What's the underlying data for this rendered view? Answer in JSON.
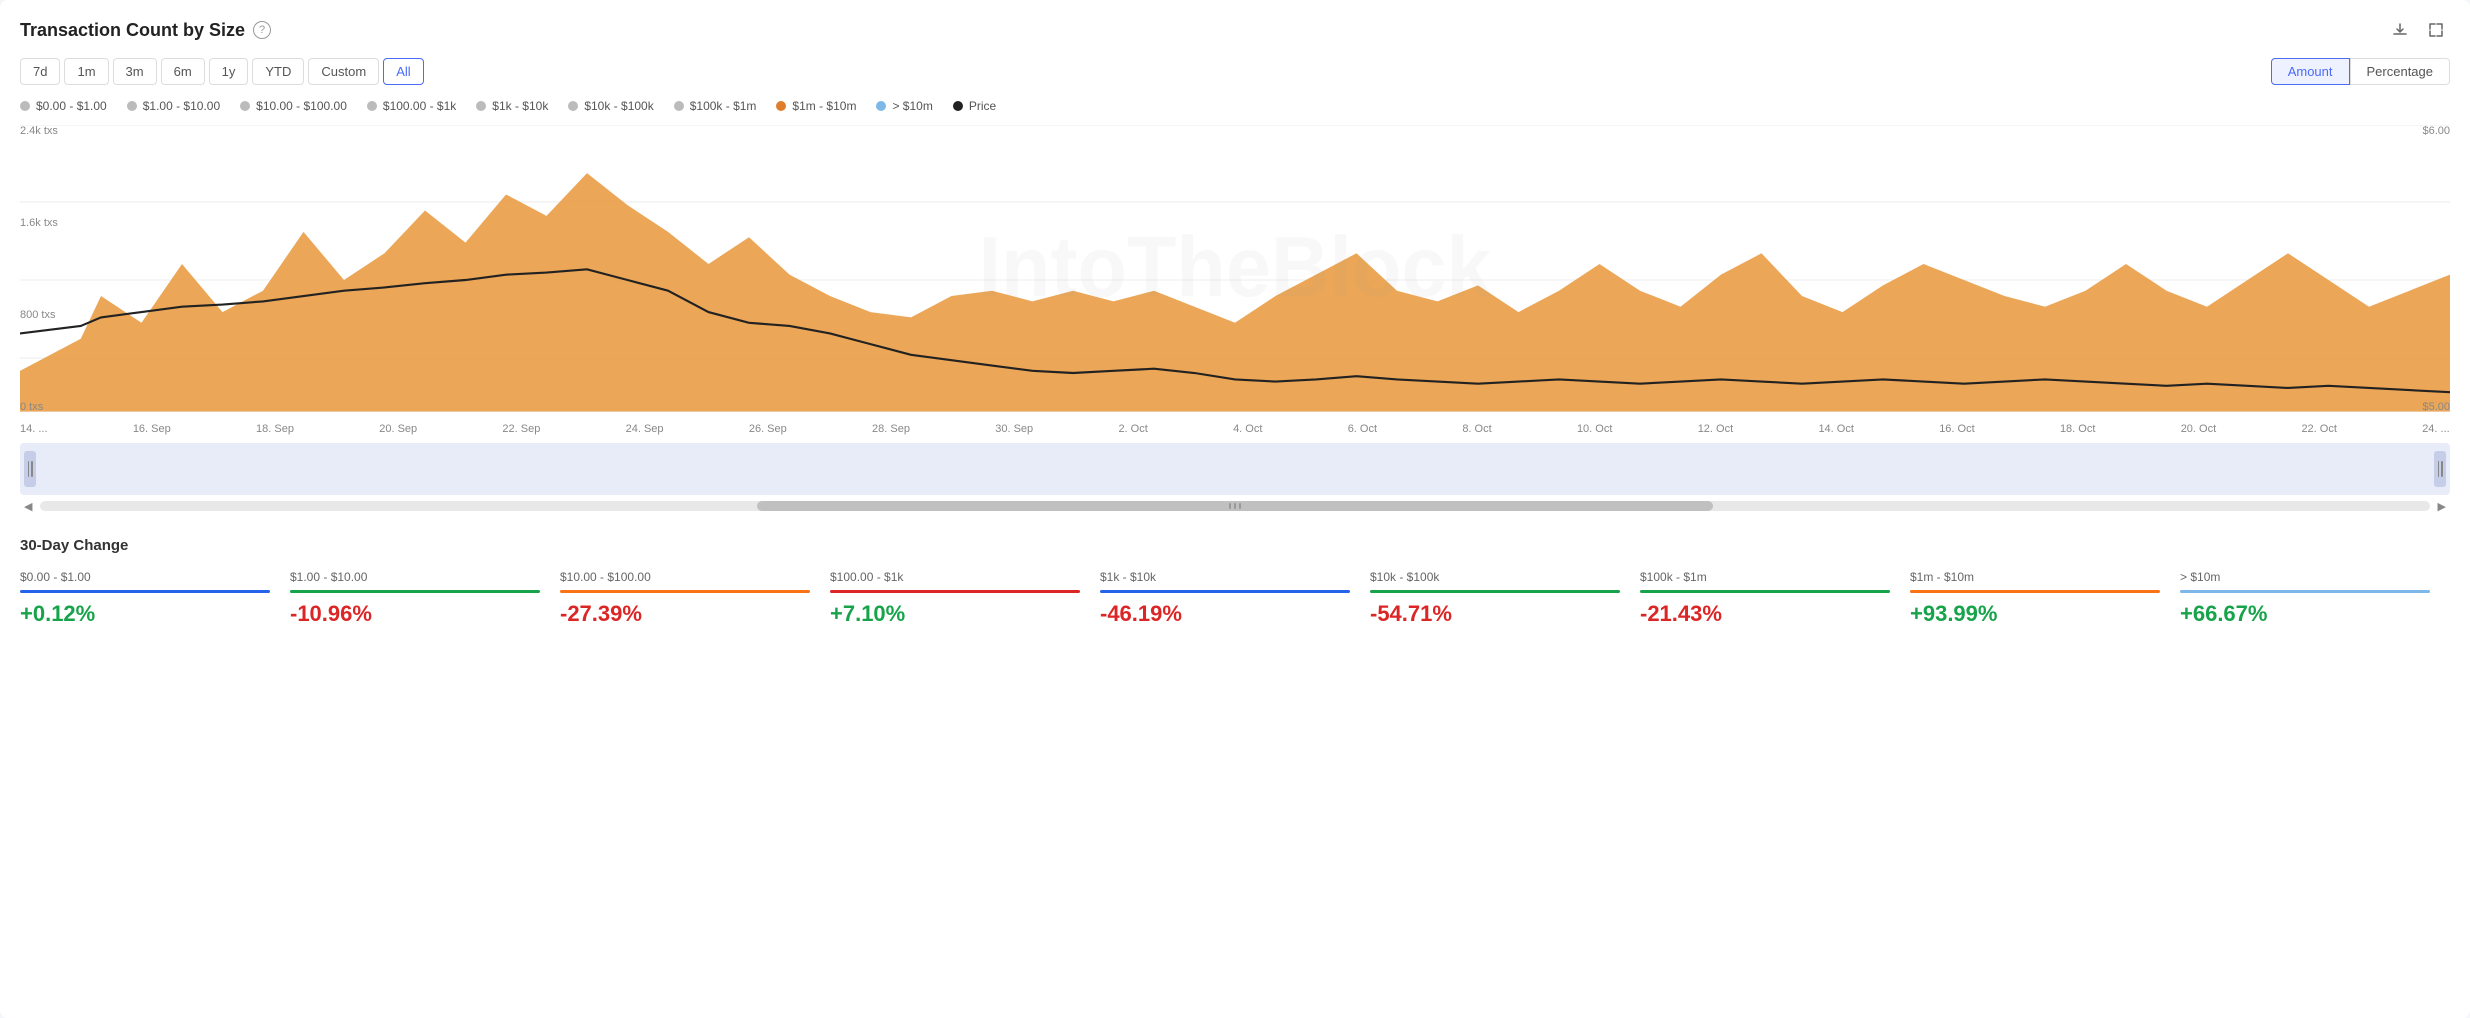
{
  "title": "Transaction Count by Size",
  "header": {
    "title": "Transaction Count by Size",
    "help_label": "?",
    "download_icon": "⬇",
    "expand_icon": "⤢"
  },
  "time_range": {
    "buttons": [
      {
        "label": "7d",
        "key": "7d",
        "active": false
      },
      {
        "label": "1m",
        "key": "1m",
        "active": false
      },
      {
        "label": "3m",
        "key": "3m",
        "active": false
      },
      {
        "label": "6m",
        "key": "6m",
        "active": false
      },
      {
        "label": "1y",
        "key": "1y",
        "active": false
      },
      {
        "label": "YTD",
        "key": "ytd",
        "active": false
      },
      {
        "label": "Custom",
        "key": "custom",
        "active": false
      },
      {
        "label": "All",
        "key": "all",
        "active": true
      }
    ]
  },
  "view_toggle": {
    "buttons": [
      {
        "label": "Amount",
        "key": "amount",
        "active": true
      },
      {
        "label": "Percentage",
        "key": "percentage",
        "active": false
      }
    ]
  },
  "legend": [
    {
      "label": "$0.00 - $1.00",
      "color": "#bbb",
      "type": "dot"
    },
    {
      "label": "$1.00 - $10.00",
      "color": "#bbb",
      "type": "dot"
    },
    {
      "label": "$10.00 - $100.00",
      "color": "#bbb",
      "type": "dot"
    },
    {
      "label": "$100.00 - $1k",
      "color": "#bbb",
      "type": "dot"
    },
    {
      "label": "$1k - $10k",
      "color": "#bbb",
      "type": "dot"
    },
    {
      "label": "$10k - $100k",
      "color": "#bbb",
      "type": "dot"
    },
    {
      "label": "$100k - $1m",
      "color": "#bbb",
      "type": "dot"
    },
    {
      "label": "$1m - $10m",
      "color": "#e07d2a",
      "type": "dot"
    },
    {
      "label": "> $10m",
      "color": "#7eb8e8",
      "type": "dot"
    },
    {
      "label": "Price",
      "color": "#222",
      "type": "dot"
    }
  ],
  "chart": {
    "y_axis_left": [
      "2.4k txs",
      "1.6k txs",
      "800 txs",
      "0 txs"
    ],
    "y_axis_right": [
      "$6.00",
      "",
      "",
      "$5.00"
    ],
    "x_axis": [
      "14. ...",
      "16. Sep",
      "18. Sep",
      "20. Sep",
      "22. Sep",
      "24. Sep",
      "26. Sep",
      "28. Sep",
      "30. Sep",
      "2. Oct",
      "4. Oct",
      "6. Oct",
      "8. Oct",
      "10. Oct",
      "12. Oct",
      "14. Oct",
      "16. Oct",
      "18. Oct",
      "20. Oct",
      "22. Oct",
      "24. ..."
    ],
    "watermark": "IntoTheBlock"
  },
  "thirty_day_change": {
    "title": "30-Day Change",
    "items": [
      {
        "label": "$0.00 - $1.00",
        "value": "+0.12%",
        "positive": true,
        "bar_color": "#2563eb"
      },
      {
        "label": "$1.00 - $10.00",
        "value": "-10.96%",
        "positive": false,
        "bar_color": "#16a34a"
      },
      {
        "label": "$10.00 - $100.00",
        "value": "-27.39%",
        "positive": false,
        "bar_color": "#f97316"
      },
      {
        "label": "$100.00 - $1k",
        "value": "+7.10%",
        "positive": true,
        "bar_color": "#dc2626"
      },
      {
        "label": "$1k - $10k",
        "value": "-46.19%",
        "positive": false,
        "bar_color": "#2563eb"
      },
      {
        "label": "$10k - $100k",
        "value": "-54.71%",
        "positive": false,
        "bar_color": "#16a34a"
      },
      {
        "label": "$100k - $1m",
        "value": "-21.43%",
        "positive": false,
        "bar_color": "#16a34a"
      },
      {
        "label": "$1m - $10m",
        "value": "+93.99%",
        "positive": true,
        "bar_color": "#f97316"
      },
      {
        "label": "> $10m",
        "value": "+66.67%",
        "positive": true,
        "bar_color": "#7eb8e8"
      }
    ]
  }
}
